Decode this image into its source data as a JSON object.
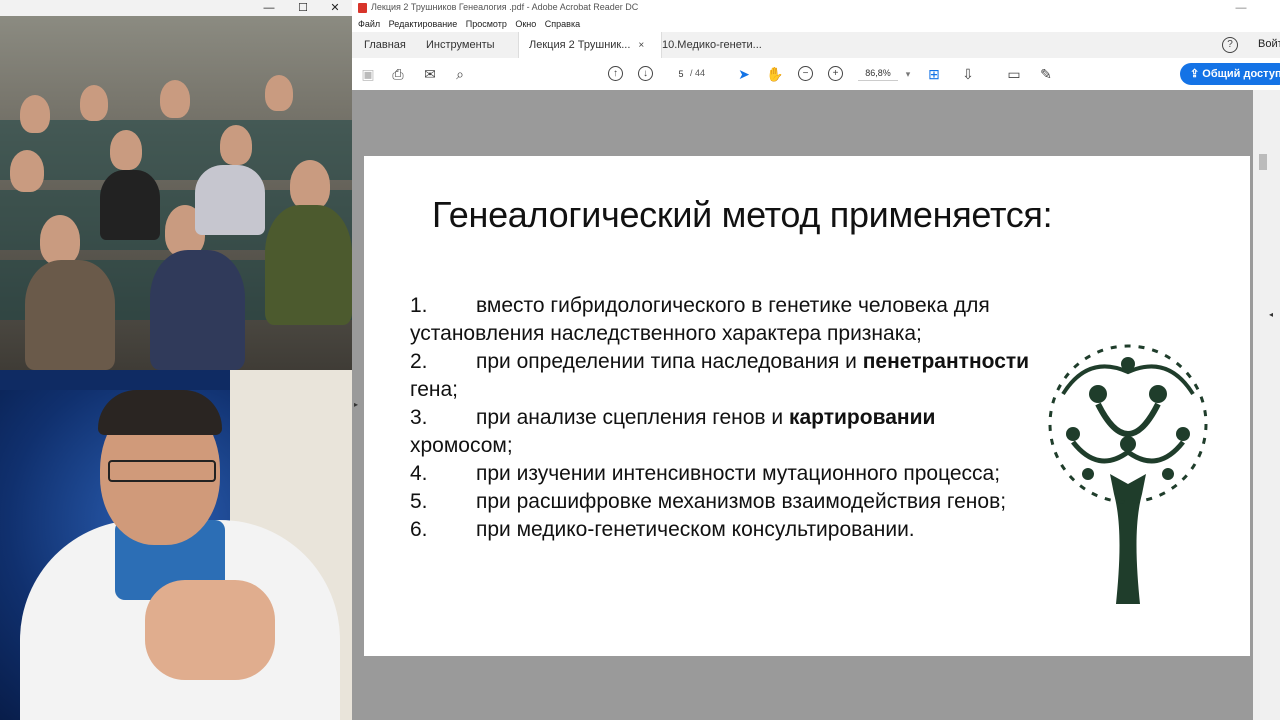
{
  "video_window": {
    "minimize": "—",
    "maximize": "☐",
    "close": "✕"
  },
  "acrobat": {
    "title": "Лекция 2 Трушников Генеалогия .pdf - Adobe Acrobat Reader DC",
    "menu": [
      "Файл",
      "Редактирование",
      "Просмотр",
      "Окно",
      "Справка"
    ],
    "tabs": {
      "home": "Главная",
      "tools": "Инструменты",
      "doc1": "Лекция 2 Трушник...",
      "doc2": "10.Медико-генети..."
    },
    "tab_close": "×",
    "help": "?",
    "signin": "Войти",
    "toolbar": {
      "page_current": "5",
      "page_total": "/ 44",
      "zoom": "86,8%",
      "share": "Общий доступ"
    }
  },
  "slide": {
    "title": "Генеалогический метод применяется:",
    "items": [
      {
        "num": "1.",
        "pre": "вместо гибридологического в генетике человека для установления наследственного характера признака;",
        "bold": "",
        "post": ""
      },
      {
        "num": "2.",
        "pre": "при определении типа наследования и ",
        "bold": "пенетрантности",
        "post": " гена;"
      },
      {
        "num": "3.",
        "pre": "при анализе сцепления генов и ",
        "bold": "картировании",
        "post": " хромосом;"
      },
      {
        "num": "4.",
        "pre": "при изучении интенсивности мутационного процесса;",
        "bold": "",
        "post": ""
      },
      {
        "num": "5.",
        "pre": "при расшифровке механизмов взаимодействия генов;",
        "bold": "",
        "post": ""
      },
      {
        "num": "6.",
        "pre": "при медико-генетическом консультировании.",
        "bold": "",
        "post": ""
      }
    ]
  },
  "colors": {
    "tree": "#1f3d2b",
    "share_blue": "#1473e6",
    "doc_bg": "#9a9a9a"
  },
  "icons": [
    "save-icon",
    "print-icon",
    "mail-icon",
    "search-icon",
    "page-up-icon",
    "page-down-icon",
    "select-arrow-icon",
    "hand-icon",
    "zoom-out-icon",
    "zoom-in-icon",
    "fit-page-icon",
    "scroll-mode-icon",
    "comment-icon",
    "pen-icon",
    "share-icon"
  ]
}
